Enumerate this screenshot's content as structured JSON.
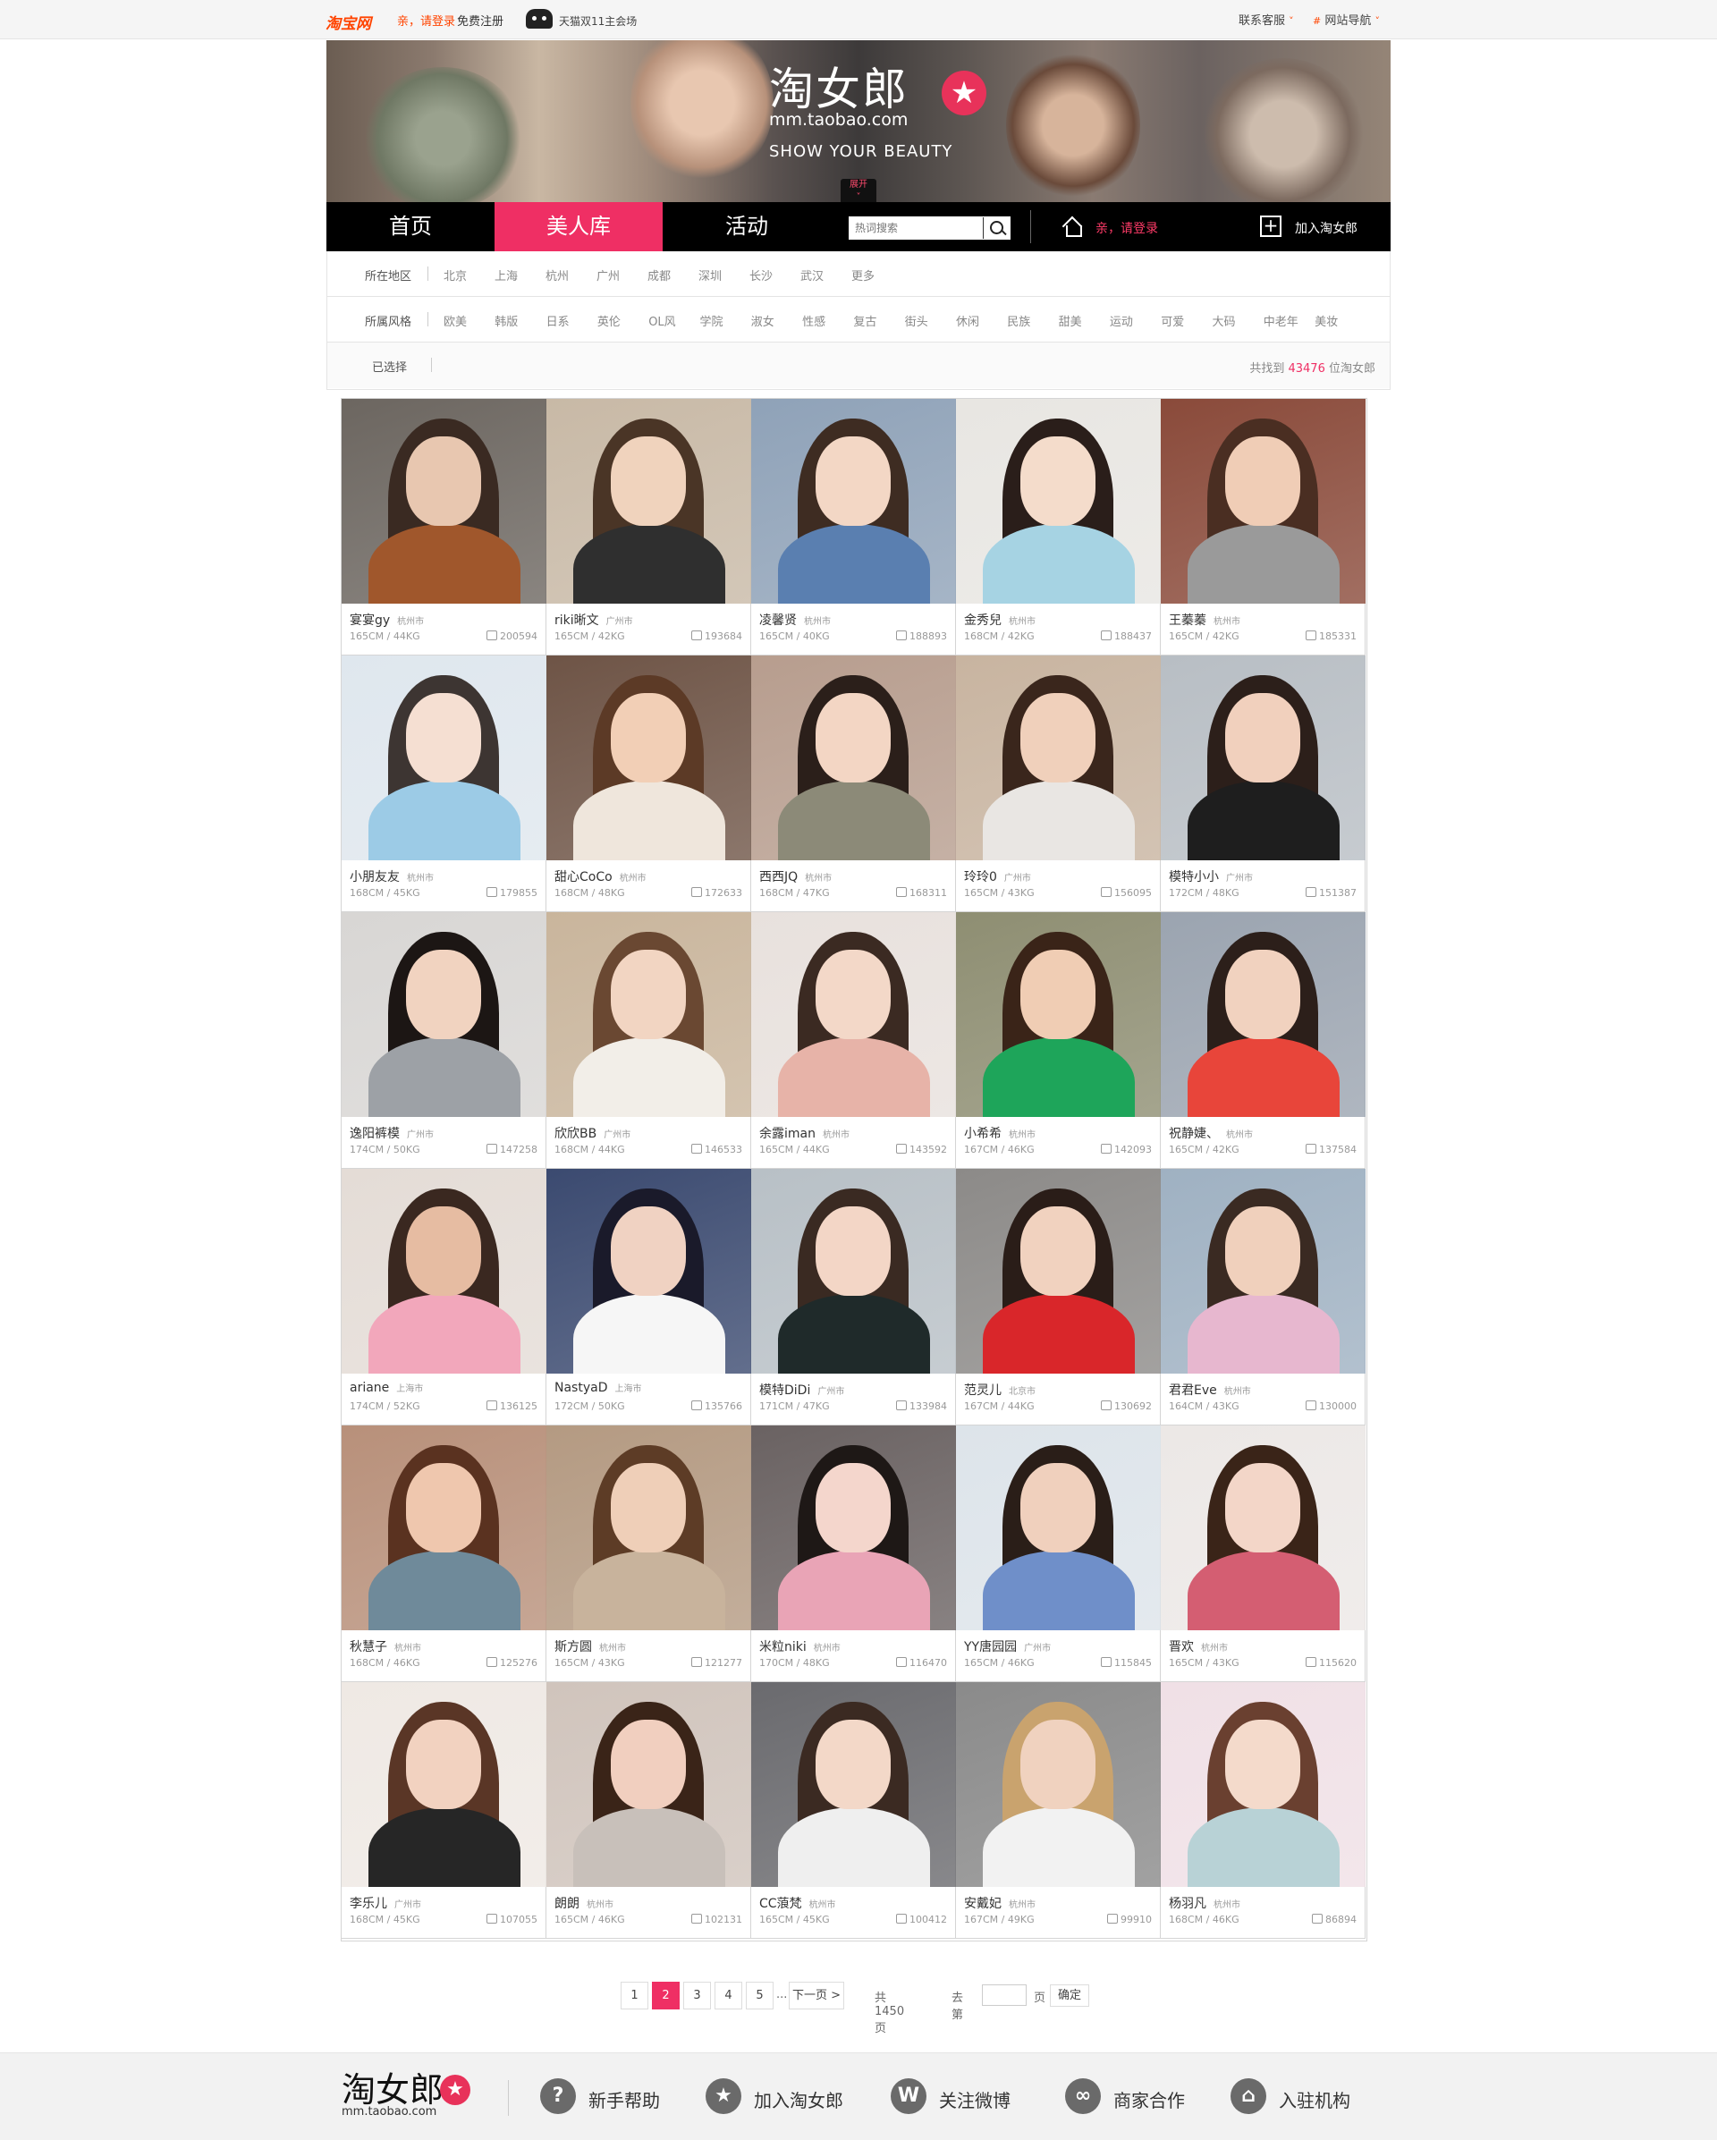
{
  "topbar": {
    "logo": "淘宝网",
    "login": "亲，请登录",
    "register": "免费注册",
    "tmall": "天猫双11主会场",
    "contact": "联系客服",
    "site_nav": "网站导航"
  },
  "banner": {
    "brand": "淘女郎",
    "url": "mm.taobao.com",
    "slogan": "SHOW YOUR BEAUTY",
    "expand": "展开"
  },
  "nav": {
    "items": [
      "首页",
      "美人库",
      "活动"
    ],
    "search_placeholder": "热词搜索",
    "login": "亲，请登录",
    "join": "加入淘女郎"
  },
  "filters": {
    "region_label": "所在地区",
    "regions": [
      "北京",
      "上海",
      "杭州",
      "广州",
      "成都",
      "深圳",
      "长沙",
      "武汉",
      "更多"
    ],
    "style_label": "所属风格",
    "styles": [
      "欧美",
      "韩版",
      "日系",
      "英伦",
      "OL风",
      "学院",
      "淑女",
      "性感",
      "复古",
      "街头",
      "休闲",
      "民族",
      "甜美",
      "运动",
      "可爱",
      "大码",
      "中老年",
      "美妆"
    ],
    "selected_label": "已选择",
    "found_prefix": "共找到",
    "found_count": "43476",
    "found_suffix": "位淘女郎"
  },
  "models": [
    {
      "name": "宴宴gy",
      "city": "杭州市",
      "stat": "165CM / 44KG",
      "likes": "200594",
      "palette": [
        "#6c6660",
        "#3a2a22",
        "#e8c7b0",
        "#a0572c"
      ]
    },
    {
      "name": "riki晰文",
      "city": "广州市",
      "stat": "165CM / 42KG",
      "likes": "193684",
      "palette": [
        "#c8b9a6",
        "#4a3526",
        "#f0d3bd",
        "#2f2f2f"
      ]
    },
    {
      "name": "凌馨贤",
      "city": "杭州市",
      "stat": "165CM / 40KG",
      "likes": "188893",
      "palette": [
        "#8fa2b8",
        "#3e2c22",
        "#f3d7c5",
        "#5a7fb0"
      ]
    },
    {
      "name": "金秀兒",
      "city": "杭州市",
      "stat": "168CM / 42KG",
      "likes": "188437",
      "palette": [
        "#e8e6e2",
        "#2a1e1a",
        "#f4dccb",
        "#a6d3e3"
      ]
    },
    {
      "name": "王蓁蓁",
      "city": "杭州市",
      "stat": "165CM / 42KG",
      "likes": "185331",
      "palette": [
        "#8a4a3a",
        "#4a2e22",
        "#f0cdb6",
        "#9a9a9a"
      ]
    },
    {
      "name": "小朋友友",
      "city": "杭州市",
      "stat": "168CM / 45KG",
      "likes": "179855",
      "palette": [
        "#dfe7ee",
        "#3d3532",
        "#f5dfd2",
        "#9ccbe6"
      ]
    },
    {
      "name": "甜心CoCo",
      "city": "杭州市",
      "stat": "168CM / 48KG",
      "likes": "172633",
      "palette": [
        "#6e5446",
        "#5c3a26",
        "#f2cfb6",
        "#efe6dc"
      ]
    },
    {
      "name": "西西JQ",
      "city": "杭州市",
      "stat": "168CM / 47KG",
      "likes": "168311",
      "palette": [
        "#b79d8e",
        "#2b1f1a",
        "#f3d6c4",
        "#8c8a78"
      ]
    },
    {
      "name": "玲玲0",
      "city": "广州市",
      "stat": "165CM / 43KG",
      "likes": "156095",
      "palette": [
        "#c8b4a0",
        "#3a261c",
        "#f0d0bb",
        "#e9e6e3"
      ]
    },
    {
      "name": "模特小小",
      "city": "广州市",
      "stat": "172CM / 48KG",
      "likes": "151387",
      "palette": [
        "#b8bec4",
        "#2c1f1a",
        "#f1d0bd",
        "#1e1e1e"
      ]
    },
    {
      "name": "逸阳裤模",
      "city": "广州市",
      "stat": "174CM / 50KG",
      "likes": "147258",
      "palette": [
        "#d8d6d4",
        "#1c1614",
        "#f1d3c0",
        "#9da1a6"
      ]
    },
    {
      "name": "欣欣BB",
      "city": "广州市",
      "stat": "168CM / 44KG",
      "likes": "146533",
      "palette": [
        "#c9b59c",
        "#6a4832",
        "#f2d5c2",
        "#f2eee8"
      ]
    },
    {
      "name": "余露iman",
      "city": "杭州市",
      "stat": "165CM / 44KG",
      "likes": "143592",
      "palette": [
        "#e8e1dd",
        "#3b2a22",
        "#f3d8c8",
        "#e7b3a8"
      ]
    },
    {
      "name": "小希希",
      "city": "杭州市",
      "stat": "167CM / 46KG",
      "likes": "142093",
      "palette": [
        "#8e8e72",
        "#3a2418",
        "#f0cdb4",
        "#1ea55a"
      ]
    },
    {
      "name": "祝静婕、",
      "city": "杭州市",
      "stat": "165CM / 42KG",
      "likes": "137584",
      "palette": [
        "#9ba4b0",
        "#2c1f1a",
        "#f1d2bf",
        "#e8453a"
      ]
    },
    {
      "name": "ariane",
      "city": "上海市",
      "stat": "174CM / 52KG",
      "likes": "136125",
      "palette": [
        "#e4dcd6",
        "#3a2820",
        "#e6bca2",
        "#f2a7bb"
      ]
    },
    {
      "name": "NastyaD",
      "city": "上海市",
      "stat": "172CM / 50KG",
      "likes": "135766",
      "palette": [
        "#3b4a70",
        "#1a1a2a",
        "#f0d2c2",
        "#f6f6f6"
      ]
    },
    {
      "name": "模特DiDi",
      "city": "广州市",
      "stat": "171CM / 47KG",
      "likes": "133984",
      "palette": [
        "#b8c0c6",
        "#3a2a22",
        "#f3d6c6",
        "#1f2a2a"
      ]
    },
    {
      "name": "范灵儿",
      "city": "北京市",
      "stat": "167CM / 44KG",
      "likes": "130692",
      "palette": [
        "#8c8a88",
        "#2a1d18",
        "#f1d2bf",
        "#d9262a"
      ]
    },
    {
      "name": "君君Eve",
      "city": "杭州市",
      "stat": "164CM / 43KG",
      "likes": "130000",
      "palette": [
        "#9fb1c2",
        "#3a2a22",
        "#f0d0bc",
        "#e7b7cf"
      ]
    },
    {
      "name": "秋慧子",
      "city": "杭州市",
      "stat": "168CM / 46KG",
      "likes": "125276",
      "palette": [
        "#b8907a",
        "#5a3220",
        "#efc7ae",
        "#6f8a9a"
      ]
    },
    {
      "name": "斯方圆",
      "city": "杭州市",
      "stat": "165CM / 43KG",
      "likes": "121277",
      "palette": [
        "#b49a82",
        "#5d3c26",
        "#efcfb8",
        "#c8b39c"
      ]
    },
    {
      "name": "米粒niki",
      "city": "杭州市",
      "stat": "170CM / 48KG",
      "likes": "116470",
      "palette": [
        "#6a6262",
        "#1e1816",
        "#f4d6cc",
        "#e9a4b6"
      ]
    },
    {
      "name": "YY唐园园",
      "city": "广州市",
      "stat": "165CM / 46KG",
      "likes": "115845",
      "palette": [
        "#dde4ea",
        "#2a1e18",
        "#f0d0bd",
        "#6f8fc9"
      ]
    },
    {
      "name": "晋欢",
      "city": "杭州市",
      "stat": "165CM / 43KG",
      "likes": "115620",
      "palette": [
        "#ece8e6",
        "#3a2418",
        "#f3d6c8",
        "#d45e72"
      ]
    },
    {
      "name": "李乐儿",
      "city": "广州市",
      "stat": "168CM / 45KG",
      "likes": "107055",
      "palette": [
        "#efe9e4",
        "#5a3626",
        "#f2d2c0",
        "#262626"
      ]
    },
    {
      "name": "朗朗",
      "city": "杭州市",
      "stat": "165CM / 46KG",
      "likes": "102131",
      "palette": [
        "#d0c4bc",
        "#3a2418",
        "#f1cfbf",
        "#c8c0ba"
      ]
    },
    {
      "name": "CC蒗梵",
      "city": "杭州市",
      "stat": "165CM / 45KG",
      "likes": "100412",
      "palette": [
        "#6a6a6e",
        "#3b2a22",
        "#f3d8c8",
        "#efefef"
      ]
    },
    {
      "name": "安戴妃",
      "city": "杭州市",
      "stat": "167CM / 49KG",
      "likes": "99910",
      "palette": [
        "#8a8a8a",
        "#c9a36e",
        "#f0d2bf",
        "#f2f2f2"
      ]
    },
    {
      "name": "杨羽凡",
      "city": "杭州市",
      "stat": "168CM / 46KG",
      "likes": "86894",
      "palette": [
        "#f0e0e6",
        "#6a4030",
        "#f4dacb",
        "#b8d2d6"
      ]
    }
  ],
  "pager": {
    "pages": [
      "1",
      "2",
      "3",
      "4",
      "5"
    ],
    "current": "2",
    "ellipsis": "...",
    "next": "下一页 >",
    "total": "共1450页",
    "goto": "去第",
    "page_unit": "页",
    "confirm": "确定"
  },
  "footer": {
    "brand": "淘女郎",
    "url": "mm.taobao.com",
    "links": [
      "新手帮助",
      "加入淘女郎",
      "关注微博",
      "商家合作",
      "入驻机构"
    ]
  }
}
